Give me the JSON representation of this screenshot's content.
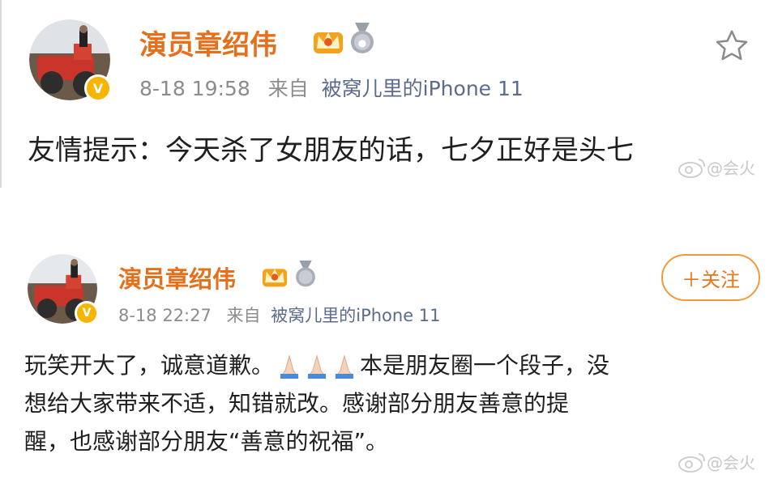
{
  "posts": [
    {
      "username": "演员章绍伟",
      "time": "8-18 19:58",
      "source_prefix": "来自",
      "source_device": "被窝儿里的iPhone 11",
      "text": "友情提示：今天杀了女朋友的话，七夕正好是头七",
      "action_icon": "star-icon"
    },
    {
      "username": "演员章绍伟",
      "time": "8-18 22:27",
      "source_prefix": "来自",
      "source_device": "被窝儿里的iPhone 11",
      "follow_label": "＋关注",
      "text_part1": "玩笑开大了，诚意道歉。",
      "text_part2": "本是朋友圈一个段子，没",
      "text_line2": "想给大家带来不适，知错就改。感谢部分朋友善意的提",
      "text_line3": "醒，也感谢部分朋友“善意的祝福”。",
      "emoji": "folded-hands-icon x3"
    }
  ],
  "watermark": "@会火",
  "colors": {
    "username": "#e86f1a",
    "meta": "#8c8c8c",
    "source": "#5b6b8c",
    "verified": "#f7b500",
    "follow_border": "#f29a3a"
  }
}
